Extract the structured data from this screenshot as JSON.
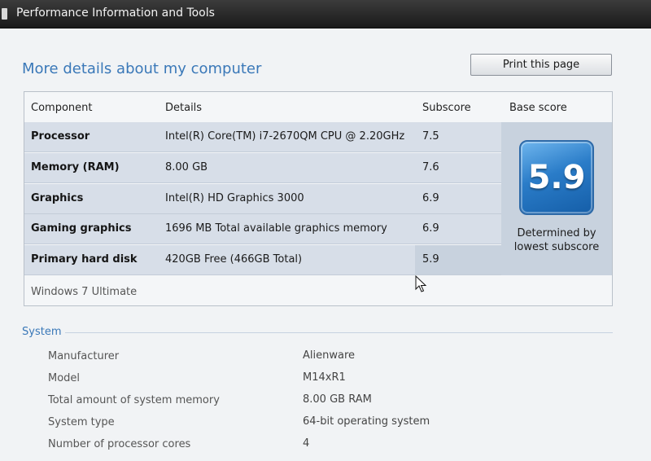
{
  "window": {
    "title": "Performance Information and Tools"
  },
  "page": {
    "heading": "More details about my computer",
    "print_button_label": "Print this page"
  },
  "score_table": {
    "headers": {
      "component": "Component",
      "details": "Details",
      "subscore": "Subscore",
      "base_score": "Base score"
    },
    "rows": [
      {
        "component": "Processor",
        "details": "Intel(R) Core(TM) i7-2670QM CPU @ 2.20GHz",
        "subscore": "7.5"
      },
      {
        "component": "Memory (RAM)",
        "details": "8.00 GB",
        "subscore": "7.6"
      },
      {
        "component": "Graphics",
        "details": "Intel(R) HD Graphics 3000",
        "subscore": "6.9"
      },
      {
        "component": "Gaming graphics",
        "details": "1696 MB Total available graphics memory",
        "subscore": "6.9"
      },
      {
        "component": "Primary hard disk",
        "details": "420GB Free (466GB Total)",
        "subscore": "5.9"
      }
    ],
    "base_score": "5.9",
    "base_score_caption": "Determined by lowest subscore",
    "edition": "Windows 7 Ultimate"
  },
  "system": {
    "section_title": "System",
    "items": [
      {
        "label": "Manufacturer",
        "value": "Alienware"
      },
      {
        "label": "Model",
        "value": "M14xR1"
      },
      {
        "label": "Total amount of system memory",
        "value": "8.00 GB RAM"
      },
      {
        "label": "System type",
        "value": "64-bit operating system"
      },
      {
        "label": "Number of processor cores",
        "value": "4"
      }
    ]
  },
  "colors": {
    "accent": "#3a78b8",
    "row_background": "#d7dee8",
    "badge_blue": "#2a7cc8"
  },
  "icons": {
    "app_icon": "window-app-icon",
    "badge": "windows-experience-index-badge",
    "cursor": "mouse-pointer-icon"
  }
}
